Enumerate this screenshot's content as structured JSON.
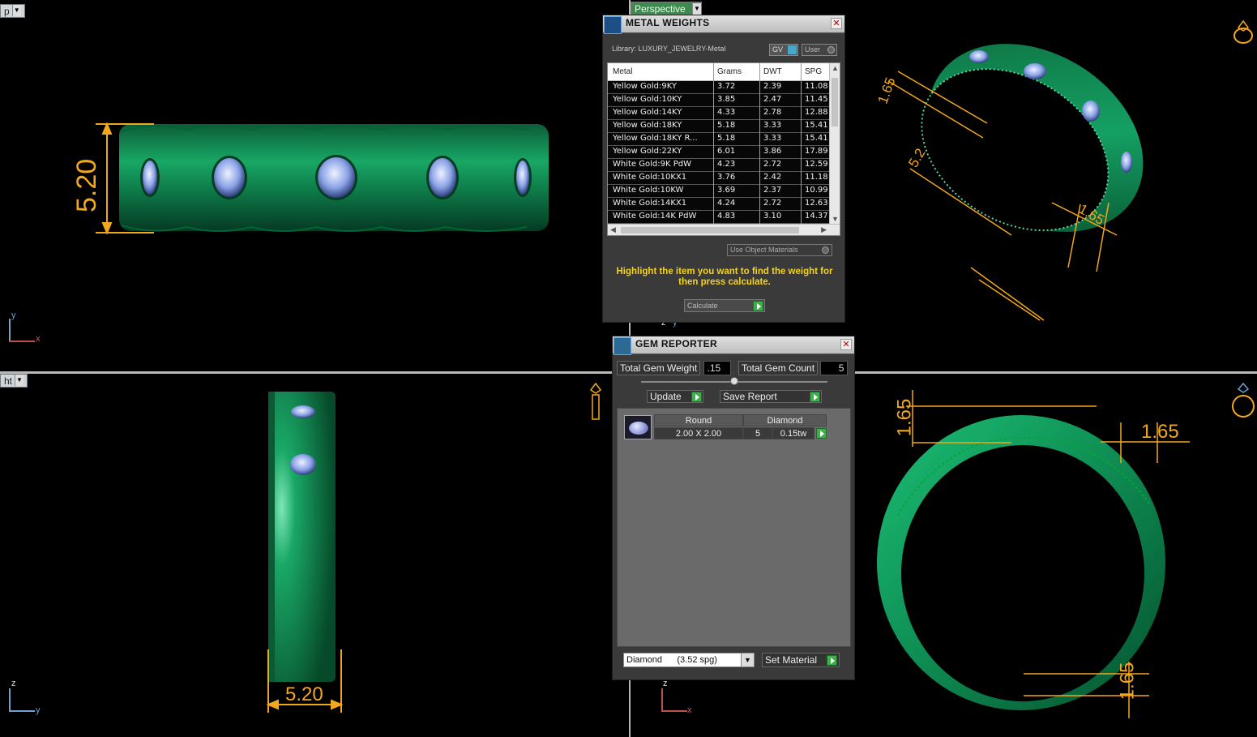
{
  "viewports": {
    "top_left": {
      "label": "p",
      "dimension": "5.20",
      "axis_v": "y",
      "axis_h": "x"
    },
    "top_right": {
      "label": "Perspective",
      "dims": [
        "1.65",
        "5.2",
        "1.65"
      ]
    },
    "bottom_left": {
      "label": "ht",
      "dimension": "5.20",
      "axis_v": "z",
      "axis_h": "y"
    },
    "bottom_right": {
      "dims": [
        "1.65",
        "1.65",
        "1.65"
      ],
      "axis_v": "z",
      "axis_h": "x"
    }
  },
  "center_axis": {
    "v": "z",
    "h": "y"
  },
  "metal_weights": {
    "title": "METAL WEIGHTS",
    "library": "Library: LUXURY_JEWELRY-Metal",
    "gv_label": "GV",
    "user_label": "User",
    "columns": [
      "Metal",
      "Grams",
      "DWT",
      "SPG"
    ],
    "rows": [
      [
        "Yellow Gold:9KY",
        "3.72",
        "2.39",
        "11.08"
      ],
      [
        "Yellow Gold:10KY",
        "3.85",
        "2.47",
        "11.45"
      ],
      [
        "Yellow Gold:14KY",
        "4.33",
        "2.78",
        "12.88"
      ],
      [
        "Yellow Gold:18KY",
        "5.18",
        "3.33",
        "15.41"
      ],
      [
        "Yellow Gold:18KY R...",
        "5.18",
        "3.33",
        "15.41"
      ],
      [
        "Yellow Gold:22KY",
        "6.01",
        "3.86",
        "17.89"
      ],
      [
        "White Gold:9K PdW",
        "4.23",
        "2.72",
        "12.59"
      ],
      [
        "White Gold:10KX1",
        "3.76",
        "2.42",
        "11.18"
      ],
      [
        "White Gold:10KW",
        "3.69",
        "2.37",
        "10.99"
      ],
      [
        "White Gold:14KX1",
        "4.24",
        "2.72",
        "12.63"
      ],
      [
        "White Gold:14K PdW",
        "4.83",
        "3.10",
        "14.37"
      ]
    ],
    "use_object_materials": "Use Object Materials",
    "hint": "Highlight the item you want to find the weight for then press calculate.",
    "calculate": "Calculate"
  },
  "gem_reporter": {
    "title": "GEM REPORTER",
    "total_weight_label": "Total Gem Weight",
    "total_weight_value": ".15",
    "total_count_label": "Total Gem Count",
    "total_count_value": "5",
    "update": "Update",
    "save_report": "Save Report",
    "gem": {
      "shape": "Round",
      "size": "2.00 X 2.00",
      "material": "Diamond",
      "count": "5",
      "weight": "0.15tw"
    },
    "material_select": "Diamond      (3.52 spg)",
    "set_material": "Set Material"
  }
}
